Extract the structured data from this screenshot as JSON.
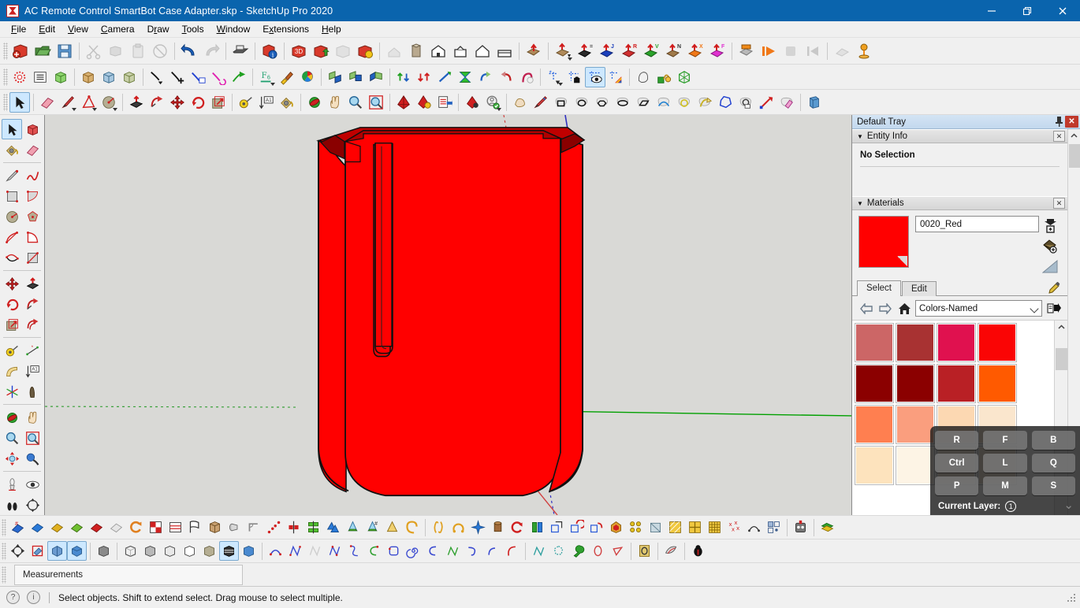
{
  "window": {
    "title": "AC Remote Control SmartBot Case Adapter.skp - SketchUp Pro 2020",
    "app_icon": "sketchup-icon",
    "controls": {
      "minimize": "minimize-icon",
      "maximize": "restore-icon",
      "close": "close-icon"
    },
    "titlebar_color": "#0a64ad"
  },
  "menu": [
    {
      "label": "File",
      "accel": "F"
    },
    {
      "label": "Edit",
      "accel": "E"
    },
    {
      "label": "View",
      "accel": "V"
    },
    {
      "label": "Camera",
      "accel": "C"
    },
    {
      "label": "Draw",
      "accel": "r"
    },
    {
      "label": "Tools",
      "accel": "T"
    },
    {
      "label": "Window",
      "accel": "W"
    },
    {
      "label": "Extensions",
      "accel": "x"
    },
    {
      "label": "Help",
      "accel": "H"
    }
  ],
  "toolbars": {
    "row1": [
      "new-document-icon",
      "open-folder-icon",
      "save-icon",
      "sep",
      "cut-scissors-icon",
      "copy-icon",
      "paste-icon",
      "erase-circle-icon",
      "sep",
      "undo-arrow-icon",
      "redo-arrow-icon",
      "sep",
      "print-icon",
      "sep",
      "model-info-icon",
      "sep",
      "3d-warehouse-get-icon",
      "3d-warehouse-share-icon",
      "extension-warehouse-icon",
      "trimble-connect-icon",
      "sep",
      "iso-view-icon",
      "top-view-icon",
      "front-view-icon",
      "right-view-icon",
      "back-view-icon",
      "left-view-icon",
      "sep",
      "section-plane-icon",
      "sep",
      "standard-views-icon",
      "iso-axis-icon",
      "blue-axis-icon",
      "red-axis-icon",
      "green-axis-icon",
      "brown-axis-icon",
      "orange-axis-icon",
      "magenta-axis-icon",
      "sep",
      "scene-manager-icon",
      "play-animation-icon",
      "stop-animation-icon",
      "prev-scene-icon",
      "sep",
      "shadow-settings-icon",
      "sun-position-icon"
    ],
    "row2": [
      "solid-tools-icon",
      "outliner-icon",
      "model-xray-icon",
      "sep",
      "group-icon",
      "component-icon",
      "make-unique-icon",
      "sep",
      "line-tool-icon",
      "add-point-icon",
      "edit-curve-icon",
      "rotate-curve-icon",
      "extend-line-icon",
      "sep",
      "font-size-icon",
      "paint-brush-icon",
      "color-wheel-icon",
      "sep",
      "sandbox-from-contours-icon",
      "sandbox-from-scratch-icon",
      "sandbox-smoove-icon",
      "sep",
      "stamp-up-icon",
      "stamp-down-icon",
      "drape-icon",
      "flip-icon",
      "detail-icon",
      "add-detail-icon",
      "flip-edge-icon",
      "sep",
      "layer-dropdown-icon",
      "layer-lock-icon",
      "layer-visible-icon",
      "layer-color-icon",
      "sep",
      "soften-edges-icon",
      "position-texture-icon",
      "mesh-icon"
    ],
    "row3": [
      "select-arrow-icon",
      "sep",
      "eraser-icon",
      "pencil-line-icon",
      "protractor-icon",
      "circle-tool-icon",
      "sep",
      "pushpull-icon",
      "followme-icon",
      "move-icon",
      "rotate-icon",
      "scale-icon",
      "sep",
      "tape-measure-icon",
      "dimension-icon",
      "paint-bucket-icon",
      "sep",
      "orbit-icon",
      "pan-hand-icon",
      "zoom-icon",
      "zoom-extents-icon",
      "sep",
      "3d-warehouse-icon",
      "warehouse-share-icon",
      "report-icon",
      "sep",
      "location-pin-icon",
      "add-location-icon",
      "sep",
      "freehand-icon",
      "draw-pencil-icon",
      "rectangle-icon",
      "circle-icon",
      "polygon-icon",
      "ellipse-icon",
      "rotated-rectangle-icon",
      "arc-icon",
      "pie-icon",
      "bezier-icon",
      "polyline-icon",
      "closed-polygon-icon",
      "arrow-line-icon",
      "eraser-pink-icon",
      "sep",
      "extrude-icon"
    ],
    "bottom1": [
      "bezier-blue-icon",
      "plane-blue-icon",
      "plane-yellow-icon",
      "plane-green-icon",
      "plane-red-icon",
      "plane-gray-icon",
      "spiral-icon",
      "split-color-icon",
      "lines-icon",
      "flag-icon",
      "box-open-icon",
      "pipe-icon",
      "angle-icon",
      "dotted-path-icon",
      "mirror-icon",
      "join-icon",
      "weld-icon",
      "water-drop-icon",
      "drop-plus-icon",
      "cone-icon",
      "curve-icon",
      "sep",
      "lathe-icon",
      "arc-round-icon",
      "star-icon",
      "cylinder-icon",
      "loop-icon",
      "split-green-icon",
      "copy-face-icon",
      "rotate-copy-icon",
      "array-copy-icon",
      "fill-icon",
      "joint-push-icon",
      "frame-icon",
      "hatch-icon",
      "grid-quad-icon",
      "grid-fine-icon",
      "scatter-icon",
      "arc-dots-icon",
      "components-icon",
      "sep",
      "robot-icon",
      "sep",
      "layers-stack-icon"
    ],
    "bottom2": [
      "axes-icon",
      "section-plane-red-icon",
      "section-display-icon",
      "section-fill-icon",
      "sep",
      "face-style-shaded-icon",
      "sep",
      "xray-icon",
      "backedges-icon",
      "wireframe-icon",
      "hidden-line-icon",
      "shaded-icon",
      "shaded-texture-icon",
      "sep",
      "monochrome-icon",
      "wireframe2-icon",
      "hiddenline2-icon",
      "shaded2-icon",
      "texture2-icon",
      "monochrome2-icon",
      "xray2-icon",
      "sep",
      "arc-tool-icon",
      "polyline-tool-icon",
      "bezier-tool-icon",
      "nurbs-icon",
      "spline-icon",
      "curve-red-icon",
      "rounded-rect-icon",
      "spiral-blue-icon",
      "arc-blue-icon",
      "zigzag-icon",
      "hook-icon",
      "arc-small-icon",
      "arc-large-icon",
      "sep",
      "polyline-teal-icon",
      "polygon-dashed-icon",
      "wrench-icon",
      "circle-red-icon",
      "triangle-red-icon",
      "sep",
      "3d-text-icon",
      "sep",
      "sandbox-tool-icon",
      "sep",
      "bug-icon"
    ]
  },
  "left_toolbar": [
    "select-arrow-icon",
    "make-component-icon",
    "paint-bucket-icon",
    "eraser-icon",
    "sep",
    "pencil-icon",
    "freehand-icon",
    "rectangle-icon",
    "rotated-rectangle-icon",
    "circle-icon",
    "polygon-icon",
    "arc-2point-icon",
    "pie-icon",
    "arc-3point-icon",
    "rotated-rect2-icon",
    "sep",
    "move-icon",
    "pushpull-icon",
    "rotate-icon",
    "followme-icon",
    "scale-icon",
    "offset-icon",
    "sep",
    "tape-measure-icon",
    "dimension-icon",
    "protractor-icon",
    "text-label-icon",
    "axes-icon",
    "3d-text-icon",
    "sep",
    "orbit-icon",
    "pan-hand-icon",
    "zoom-icon",
    "zoom-window-icon",
    "zoom-extents-icon",
    "previous-view-icon",
    "sep",
    "position-camera-icon",
    "look-around-icon",
    "walk-icon",
    "section-plane-icon"
  ],
  "tray": {
    "title": "Default Tray",
    "pin_icon": "pin-icon",
    "close_icon": "close-icon",
    "entity_info": {
      "header": "Entity Info",
      "collapse_icon": "triangle-down-icon",
      "close_icon": "close-icon",
      "status": "No Selection"
    },
    "materials": {
      "header": "Materials",
      "collapse_icon": "triangle-down-icon",
      "close_icon": "close-icon",
      "current_swatch_color": "#ff0000",
      "material_name": "0020_Red",
      "side_buttons": [
        "create-material-icon",
        "paint-bucket-add-icon",
        "display-secondary-icon"
      ],
      "tabs": [
        {
          "label": "Select",
          "selected": true
        },
        {
          "label": "Edit",
          "selected": false
        }
      ],
      "eyedropper_icon": "eyedropper-icon",
      "nav": {
        "back_icon": "arrow-left-icon",
        "forward_icon": "arrow-right-icon",
        "home_icon": "home-icon",
        "library": "Colors-Named",
        "chevron_icon": "chevron-down-icon",
        "details_icon": "details-arrow-icon"
      },
      "swatches": [
        "#cc6666",
        "#a83232",
        "#e0114f",
        "#fa0505",
        "#8b0000",
        "#8b0000",
        "#b92025",
        "#ff5a00",
        "#ff7f50",
        "#fa9e7e",
        "#fcd8b2",
        "#fae6cd",
        "#fde3bd",
        "#fdf4e5",
        "#f8ead6",
        "#f5e6d0"
      ]
    }
  },
  "keyboard_overlay": {
    "rows": [
      [
        "R",
        "F",
        "B"
      ],
      [
        "Ctrl",
        "L",
        "Q"
      ],
      [
        "P",
        "M",
        "S"
      ]
    ],
    "footer_label": "Current Layer:",
    "footer_value": "1"
  },
  "measurements": {
    "label": "Measurements",
    "value": ""
  },
  "statusbar": {
    "help_icon": "help-icon",
    "info_icon": "info-icon",
    "text": "Select objects. Shift to extend select. Drag mouse to select multiple."
  },
  "viewport": {
    "background": "#d9d9d6",
    "model_color": "#ff0000",
    "model_shadow_color": "#b30000",
    "model_name": "AC Remote Control SmartBot Case Adapter",
    "axes": {
      "green_axis_color": "#00a000",
      "red_axis_color": "#d04040",
      "blue_axis_color": "#3030c0"
    }
  }
}
